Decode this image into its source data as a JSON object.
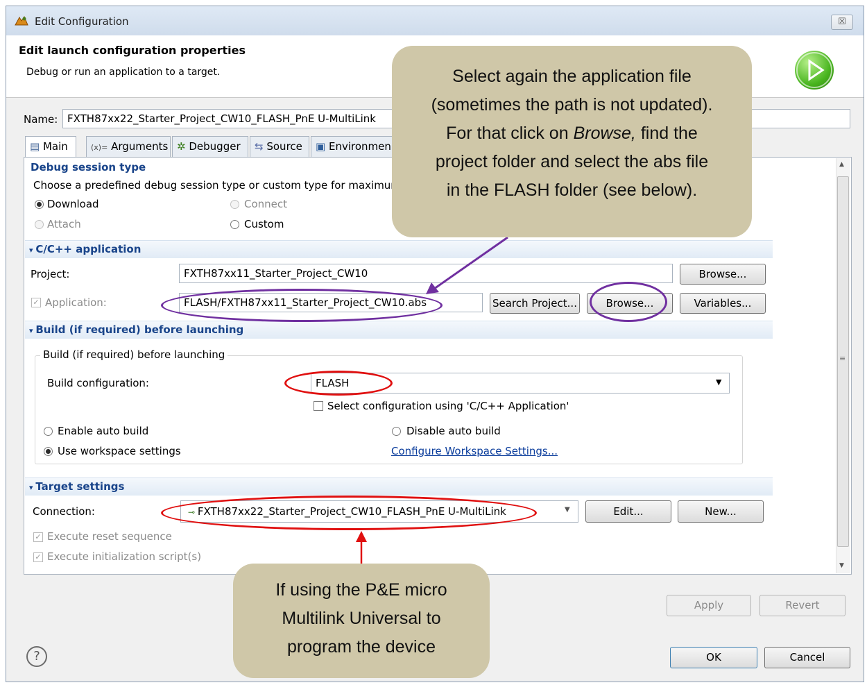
{
  "window": {
    "title": "Edit Configuration",
    "close": "☒"
  },
  "header": {
    "title": "Edit launch configuration properties",
    "subtitle": "Debug or run an application to a target."
  },
  "name": {
    "label": "Name:",
    "value": "FXTH87xx22_Starter_Project_CW10_FLASH_PnE U-MultiLink"
  },
  "tabs": [
    {
      "icon": "▤",
      "label": "Main"
    },
    {
      "icon": "(x)=",
      "label": "Arguments"
    },
    {
      "icon": "✲",
      "label": "Debugger"
    },
    {
      "icon": "⇆",
      "label": "Source"
    },
    {
      "icon": "▣",
      "label": "Environmen"
    }
  ],
  "debug_session": {
    "title": "Debug session type",
    "desc": "Choose a predefined debug session type or custom type for maximum",
    "download": "Download",
    "connect": "Connect",
    "attach": "Attach",
    "custom": "Custom"
  },
  "cpp_app": {
    "title": "C/C++ application",
    "project_label": "Project:",
    "project_value": "FXTH87xx11_Starter_Project_CW10",
    "browse": "Browse...",
    "app_label": "Application:",
    "app_value": "FLASH/FXTH87xx11_Starter_Project_CW10.abs",
    "search_project": "Search Project...",
    "browse2": "Browse...",
    "variables": "Variables..."
  },
  "build": {
    "title": "Build (if required) before launching",
    "group_title": "Build (if required) before launching",
    "config_label": "Build configuration:",
    "config_value": "FLASH",
    "select_cfg": "Select configuration using 'C/C++ Application'",
    "enable_auto": "Enable auto build",
    "disable_auto": "Disable auto build",
    "use_ws": "Use workspace settings",
    "configure_ws": "Configure Workspace Settings..."
  },
  "target": {
    "title": "Target settings",
    "connection_label": "Connection:",
    "connection_value": "FXTH87xx22_Starter_Project_CW10_FLASH_PnE U-MultiLink",
    "edit": "Edit...",
    "new": "New...",
    "reset_seq": "Execute reset sequence",
    "init_script": "Execute initialization script(s)"
  },
  "footer": {
    "apply": "Apply",
    "revert": "Revert",
    "ok": "OK",
    "cancel": "Cancel",
    "help": "?"
  },
  "callouts": {
    "top": [
      "Select again the application file",
      "(sometimes the path is not updated).",
      "For that click on ",
      "Browse,",
      " find the",
      "project folder and select the abs file",
      "in the FLASH folder (see below)."
    ],
    "bottom": [
      "If using the P&E micro",
      "Multilink Universal to",
      "program the device"
    ]
  },
  "colors": {
    "purple": "#7030a0",
    "red": "#e01010",
    "callout": "#cfc7a8",
    "section_text": "#19448a"
  }
}
